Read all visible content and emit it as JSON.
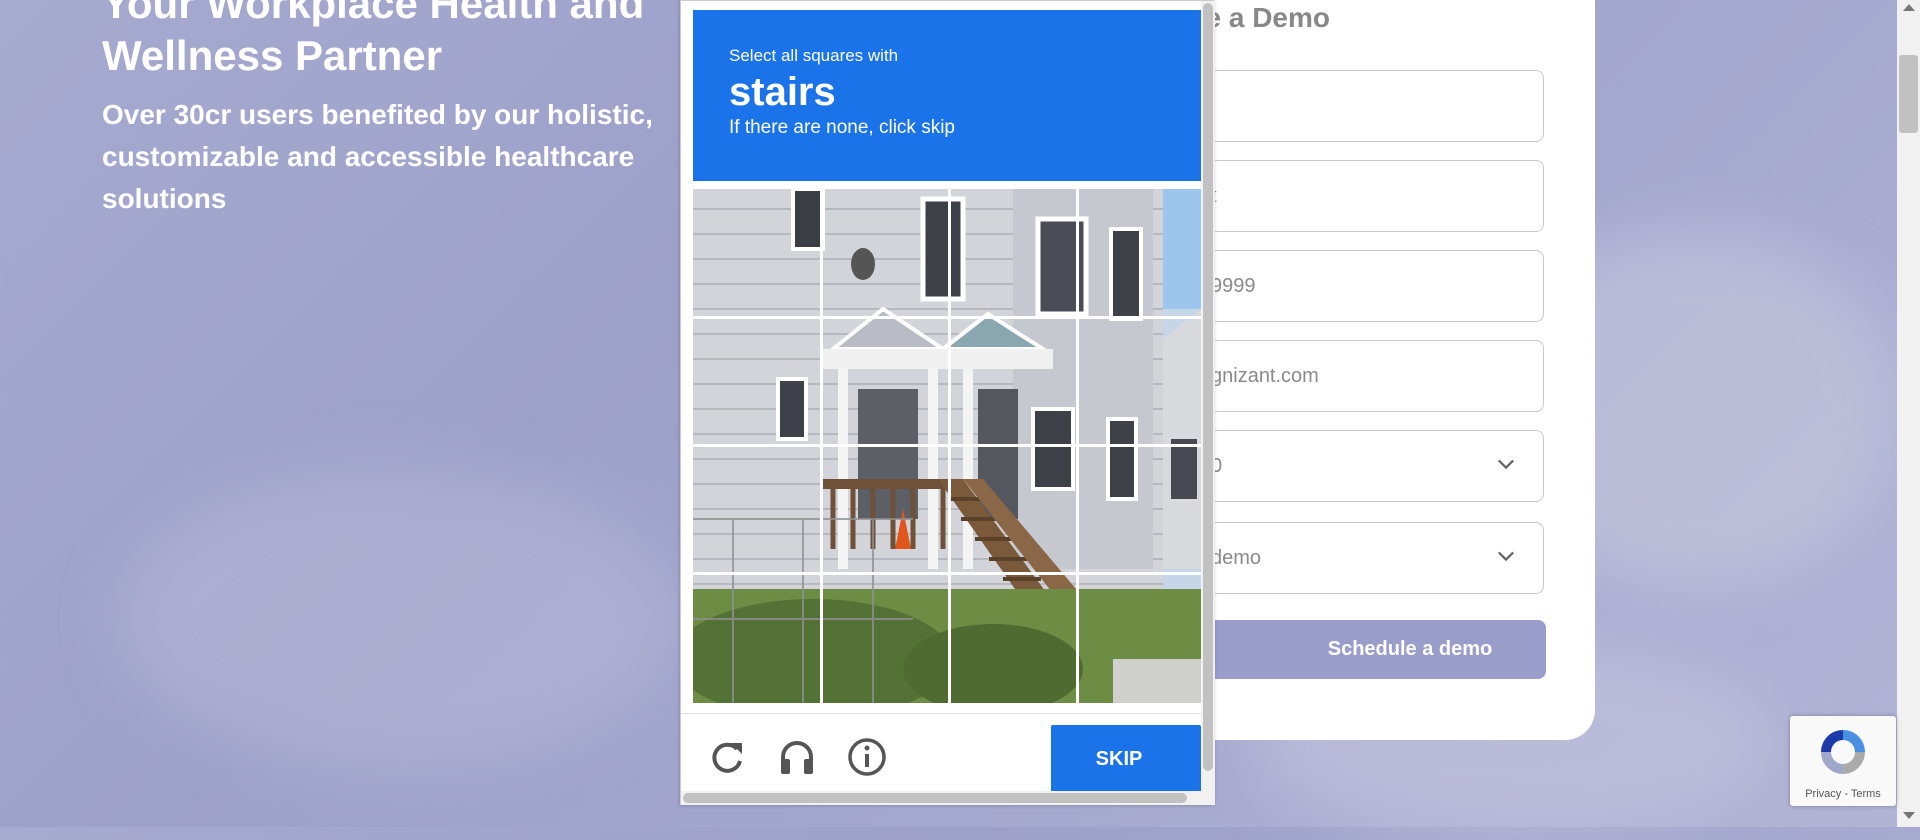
{
  "hero": {
    "title": "Your Workplace Health and Wellness Partner",
    "subtitle": "Over 30cr users benefited by our holistic, customizable and accessible healthcare solutions"
  },
  "form": {
    "title": "e a Demo",
    "fields": [
      {
        "value": ""
      },
      {
        "placeholder": "t"
      },
      {
        "placeholder": "9999"
      },
      {
        "placeholder": "gnizant.com"
      },
      {
        "value": "0",
        "icon": "chevron-down-icon"
      },
      {
        "value": "demo",
        "icon": "chevron-down-icon"
      }
    ],
    "schedule_label": "Schedule a demo"
  },
  "captcha": {
    "instruction": "Select all squares with",
    "target": "stairs",
    "hint": "If there are none, click skip",
    "icons": [
      "reload-icon",
      "headphones-icon",
      "info-icon"
    ],
    "skip_label": "SKIP",
    "header_color": "#1a73e8"
  },
  "badge": {
    "text": "Privacy - Terms",
    "icon": "recaptcha-logo-icon"
  }
}
